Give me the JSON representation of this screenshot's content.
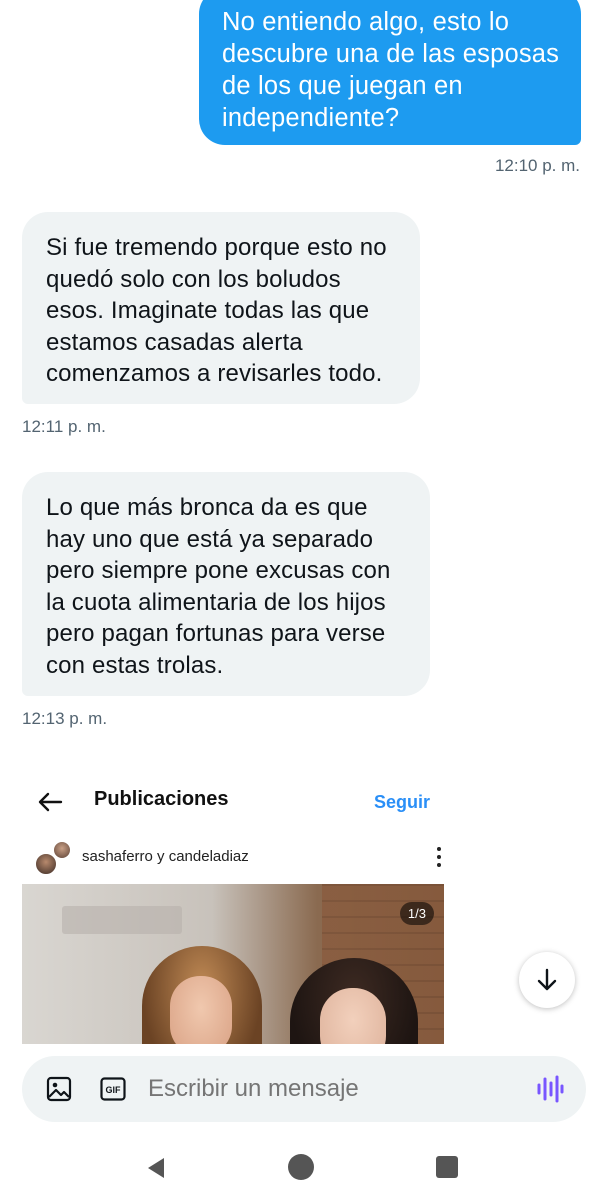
{
  "messages": {
    "outgoing": {
      "text": "No entiendo algo, esto lo descubre una de las esposas de los que juegan en independiente?",
      "time": "12:10 p. m."
    },
    "incoming_1": {
      "text": "Si fue tremendo porque esto no quedó solo con los boludos esos. Imaginate todas las que estamos casadas alerta comenzamos a revisarles todo.",
      "time": "12:11 p. m."
    },
    "incoming_2": {
      "text": "Lo que más bronca da es que hay uno que está ya separado pero siempre pone excusas con la cuota alimentaria de los hijos pero pagan fortunas para verse con estas trolas.",
      "time": "12:13 p. m."
    }
  },
  "shared_post": {
    "header_title": "Publicaciones",
    "follow_label": "Seguir",
    "authors": "sashaferro y candeladiaz",
    "counter": "1/3"
  },
  "composer": {
    "placeholder": "Escribir un mensaje"
  },
  "colors": {
    "outgoing_bubble": "#1d9bf0",
    "incoming_bubble": "#eff3f4",
    "follow_link": "#2a8ff7",
    "voice_icon": "#7856ff"
  },
  "icons": [
    "back-arrow-icon",
    "more-vertical-icon",
    "arrow-down-icon",
    "image-icon",
    "gif-icon",
    "voice-wave-icon",
    "nav-back-icon",
    "nav-home-icon",
    "nav-recents-icon"
  ]
}
